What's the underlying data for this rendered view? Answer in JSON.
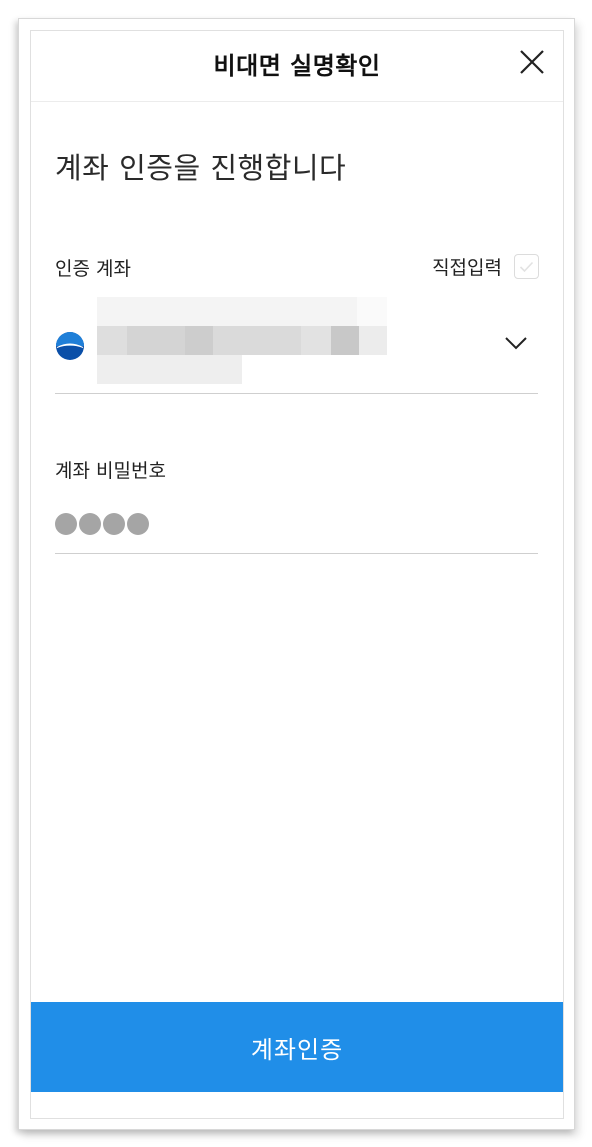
{
  "header": {
    "title": "비대면 실명확인"
  },
  "main": {
    "heading": "계좌 인증을 진행합니다",
    "account": {
      "label": "인증 계좌",
      "direct_input_label": "직접입력",
      "direct_input_checked": false
    },
    "password": {
      "label": "계좌 비밀번호",
      "masked_digits": 4
    }
  },
  "footer": {
    "submit_label": "계좌인증"
  },
  "colors": {
    "accent": "#208ee8",
    "bank_logo_top": "#1f7fd8",
    "bank_logo_bottom": "#0a4fa8"
  },
  "icons": {
    "close": "close-icon",
    "chevron": "chevron-down-icon",
    "checkbox": "checkmark-icon",
    "bank": "bank-logo-icon"
  }
}
